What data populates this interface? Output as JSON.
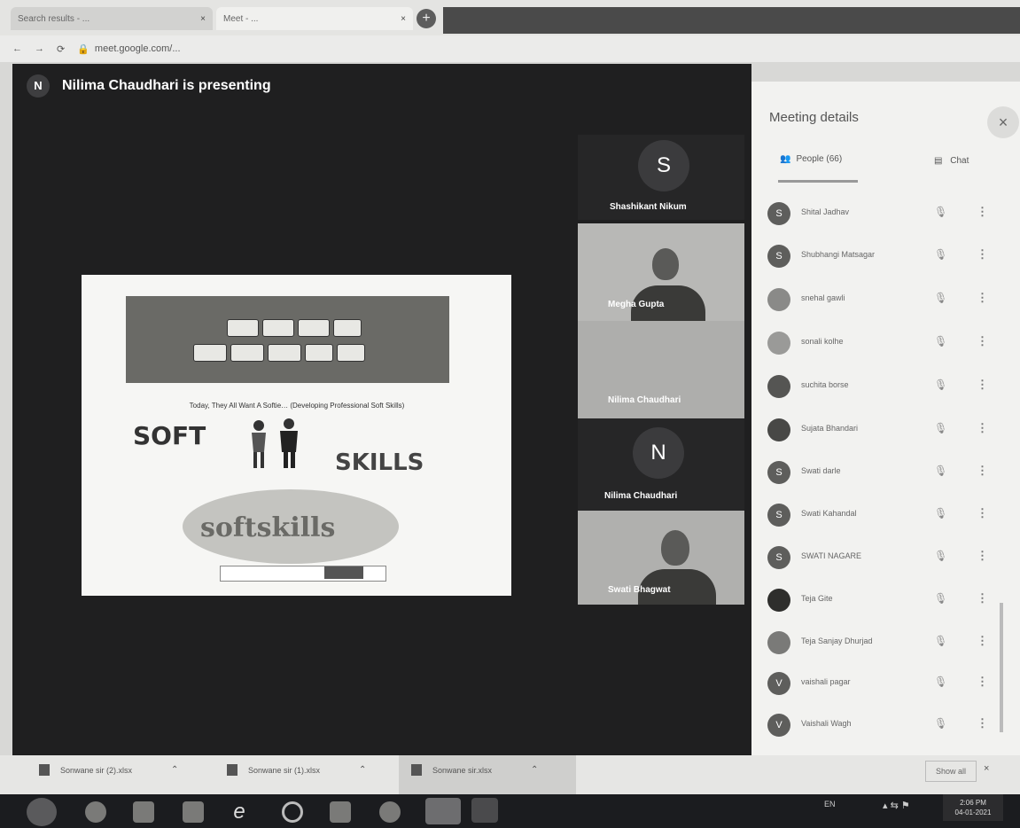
{
  "browser": {
    "tab1_title": "Search results - ...",
    "tab2_title": "Meet - ...",
    "tab_close": "×",
    "new_tab": "+",
    "url": "meet.google.com/..."
  },
  "meet": {
    "presenter_initial": "N",
    "presenting_banner": "Nilima Chaudhari is presenting",
    "tiles": [
      {
        "initial": "S",
        "name": "Shashikant Nikum"
      },
      {
        "name": "Megha Gupta"
      },
      {
        "name": "Nilima Chaudhari"
      },
      {
        "initial": "N",
        "name": "Nilima Chaudhari"
      },
      {
        "name": "Swati Bhagwat"
      }
    ]
  },
  "slide": {
    "subtitle": "Today, They All Want A Softie… (Developing Professional Soft Skills)",
    "soft": "SOFT",
    "skills": "SKILLS",
    "cloud": "softskills"
  },
  "panel": {
    "title": "Meeting details",
    "close": "×",
    "tab_people": "People (66)",
    "tab_chat": "Chat",
    "participants": [
      {
        "initial": "S",
        "name": "Shital Jadhav"
      },
      {
        "initial": "S",
        "name": "Shubhangi Matsagar"
      },
      {
        "initial": "",
        "name": "snehal gawli"
      },
      {
        "initial": "",
        "name": "sonali kolhe"
      },
      {
        "initial": "",
        "name": "suchita borse"
      },
      {
        "initial": "",
        "name": "Sujata Bhandari"
      },
      {
        "initial": "S",
        "name": "Swati darle"
      },
      {
        "initial": "S",
        "name": "Swati Kahandal"
      },
      {
        "initial": "S",
        "name": "SWATI NAGARE"
      },
      {
        "initial": "",
        "name": "Teja Gite"
      },
      {
        "initial": "",
        "name": "Teja Sanjay Dhurjad"
      },
      {
        "initial": "V",
        "name": "vaishali pagar"
      },
      {
        "initial": "V",
        "name": "Vaishali Wagh"
      }
    ]
  },
  "downloads": {
    "items": [
      "Sonwane sir (2).xlsx",
      "Sonwane sir (1).xlsx",
      "Sonwane sir.xlsx"
    ],
    "show_all": "Show all",
    "close": "×"
  },
  "taskbar": {
    "lang": "EN",
    "time": "2:06 PM",
    "date": "04-01-2021"
  }
}
